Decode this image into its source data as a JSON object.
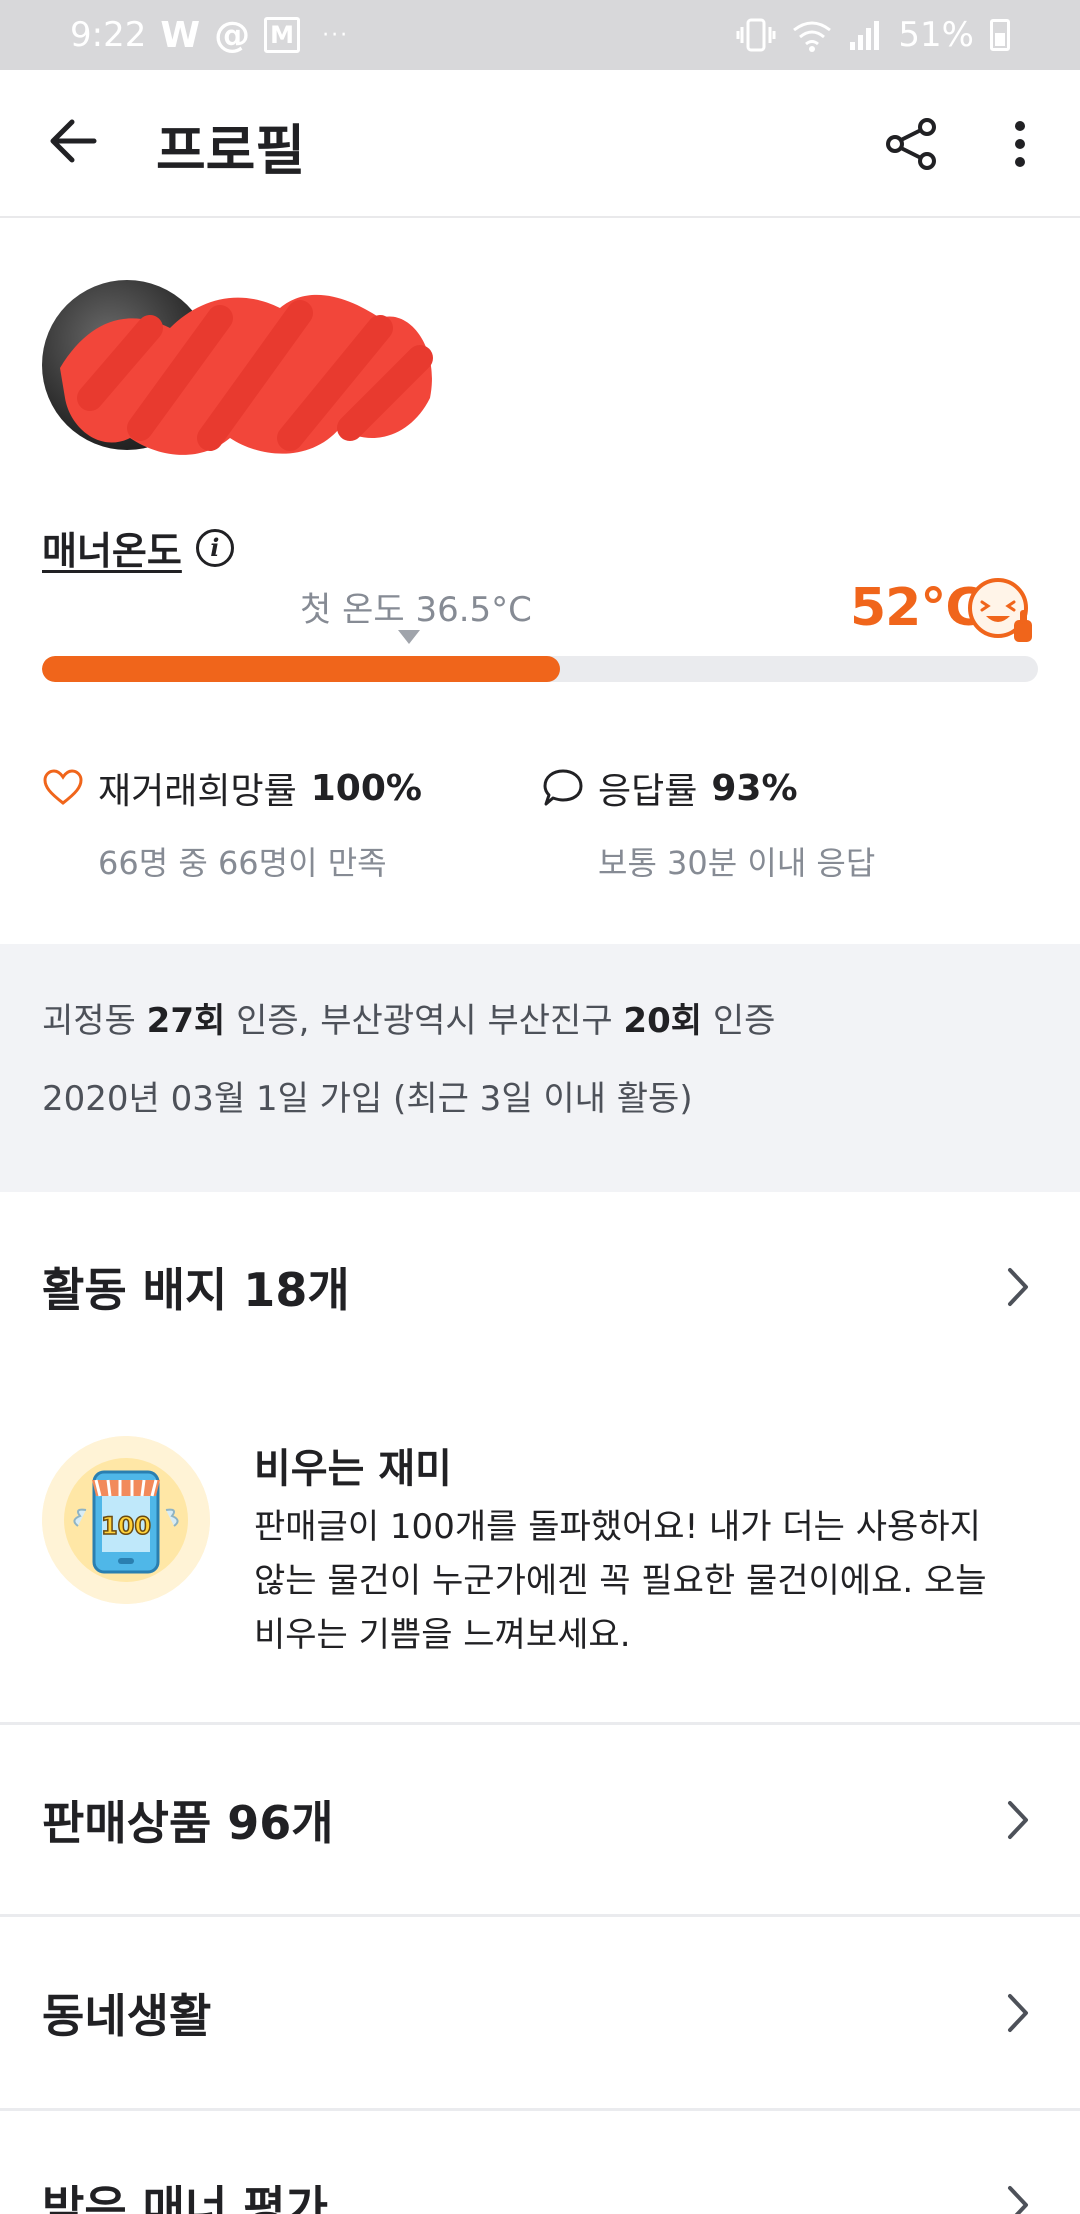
{
  "status_bar": {
    "time": "9:22",
    "app_icons": [
      "W",
      "@",
      "M"
    ],
    "more": "···",
    "battery": "51%"
  },
  "header": {
    "title": "프로필"
  },
  "manner": {
    "label": "매너온도",
    "first_temp_label": "첫 온도 36.5°C",
    "current_temp": "52°C",
    "fill_fraction": 0.52,
    "accent_color": "#f0651b"
  },
  "stats": [
    {
      "label": "재거래희망률",
      "value": "100%",
      "sub": "66명 중 66명이 만족",
      "icon": "heart-icon"
    },
    {
      "label": "응답률",
      "value": "93%",
      "sub": "보통 30분 이내 응답",
      "icon": "chat-bubble-icon"
    }
  ],
  "verification": {
    "area1": "괴정동",
    "area1_count": "27회",
    "area1_suffix": "인증,",
    "area2": "부산광역시 부산진구",
    "area2_count": "20회",
    "area2_suffix": "인증",
    "joined": "2020년 03월 1일 가입 (최근 3일 이내 활동)"
  },
  "badges_section": {
    "title": "활동 배지 18개",
    "badge": {
      "icon": "store-100-badge-icon",
      "icon_text": "100",
      "name": "비우는 재미",
      "description": "판매글이 100개를 돌파했어요! 내가 더는 사용하지 않는 물건이 누군가에겐 꼭 필요한 물건이에요. 오늘 비우는 기쁨을 느껴보세요."
    }
  },
  "sections": {
    "products": "판매상품 96개",
    "community": "동네생활",
    "reviews": "받은 매너 평가"
  }
}
